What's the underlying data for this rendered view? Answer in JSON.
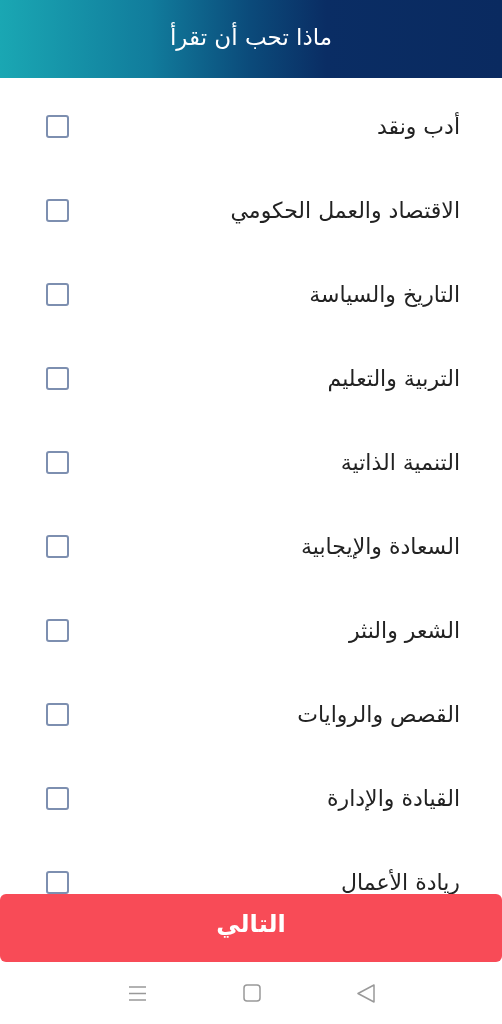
{
  "header": {
    "title": "ماذا تحب أن تقرأ"
  },
  "topics": [
    {
      "label": "أدب ونقد",
      "checked": false
    },
    {
      "label": "الاقتصاد والعمل الحكومي",
      "checked": false
    },
    {
      "label": "التاريخ والسياسة",
      "checked": false
    },
    {
      "label": "التربية والتعليم",
      "checked": false
    },
    {
      "label": "التنمية الذاتية",
      "checked": false
    },
    {
      "label": "السعادة والإيجابية",
      "checked": false
    },
    {
      "label": "الشعر والنثر",
      "checked": false
    },
    {
      "label": "القصص والروايات",
      "checked": false
    },
    {
      "label": "القيادة والإدارة",
      "checked": false
    },
    {
      "label": "ريادة الأعمال",
      "checked": false
    }
  ],
  "next_button": {
    "label": "التالي"
  }
}
